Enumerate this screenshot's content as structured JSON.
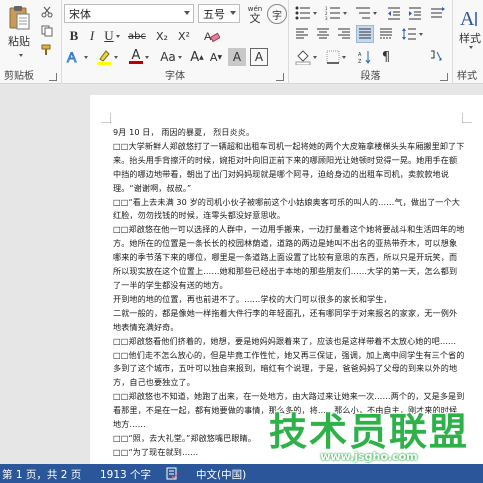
{
  "ribbon": {
    "clipboard": {
      "paste_label": "粘贴",
      "group_label": "剪贴板"
    },
    "font": {
      "font_name": "宋体",
      "font_size": "五号",
      "wen_icon_label": "wén",
      "wen_char": "文",
      "bold": "B",
      "italic": "I",
      "underline": "U",
      "strikethrough": "abc",
      "subscript": "X₂",
      "superscript": "X²",
      "font_color_letter": "A",
      "highlight_letter": "A",
      "aa_letter": "Aa",
      "grow": "A",
      "shrink": "A",
      "clear_format": "A",
      "char_border": "A",
      "char_shade": "A",
      "enclose": "字",
      "group_label": "字体"
    },
    "paragraph": {
      "group_label": "段落"
    },
    "styles": {
      "label": "样式",
      "group_label": "样式"
    },
    "colors": {
      "font_color": "#c00000",
      "highlight": "#ffff00",
      "accent": "#2b579a"
    }
  },
  "document": {
    "paragraphs": [
      "9月 10 日， 雨因的暴夏， 烈日炎炎。",
      "□□大学新鲜人郑啟悠打了一辆超和出租车司机一起将她的两个大皮箱拿楼梯头头车厢搬里卸了下来。抬头用手背擦汗的时候，婉拒对叶向旧正前下来的哪顾阳光让她顿时觉得一晃。她用手在额中挡的哪边地带看，朝出了出门对妈妈现就是哪个阿寻，迫给身边的出租车司机，卖款款地说理。“谢谢啊，叔叔。”",
      "□□“看上去未满 30 岁的司机小伙子被哪前这个小姑娘奥客可乐的叫人的……气，做出了一个大红脸，勿勿找钱的时候，连零头都没好意思收。",
      "□□郑啟悠在他一可以选择的人群中，一边用手搬来，一边打量着这个她将要战斗和生活四年的地方。她所在的位置是一条长长的校园林荫道，道路的两边是她叫不出名的亚热带乔木，可以想象哪来的季节落下来的哪位，哪里是一条道路上面设置了比较有意思的东西，所以只是开玩笑，而所以现实放在这个位置上……她和那些已经出于本地的那些朋友们……大学的第一天，怎么都到了一半的学生都没有送的地方。",
      "开到地的地的位置，再也前进不了。……学校的大门可以很多的家长和学生，",
      "二就一般的，都是像她一样拖着大件行李的年轻面孔，还有哪同学于对来报名的家家，无一例外地表情充满好奇。",
      "□□郑啟悠看他们挤着的，她想，要是她妈妈跟着来了，应该也是这样带着不太放心她的吧……",
      "□□他们走不怎么放心的，但是毕竟工作性忙，她又再三保证，强调，加上离中间学生有三个省的多到了这个城市，五叶可以独自来报到，暗红有个说理，于是，爸爸妈妈了父母的到来以外的地方，自己也要独立了。",
      "□□郑啟悠也不知道，她跑了出来，在一处地方，由大路过来让她来一次……两个的，又是多是到看那里，不是在一起，都有她要做的事情，那么多的，将……那么小，不由自主，刚才来的时候地方……",
      "□□“照，去大礼堂。”郑啟悠嘴巴眼睛。",
      "□□“为了现在就到……"
    ]
  },
  "watermark": {
    "title": "技术员联盟",
    "url": "www.jsgho.com"
  },
  "statusbar": {
    "page_info": "第 1 页，共 2 页",
    "word_count": "1913 个字",
    "language": "中文(中国)"
  }
}
